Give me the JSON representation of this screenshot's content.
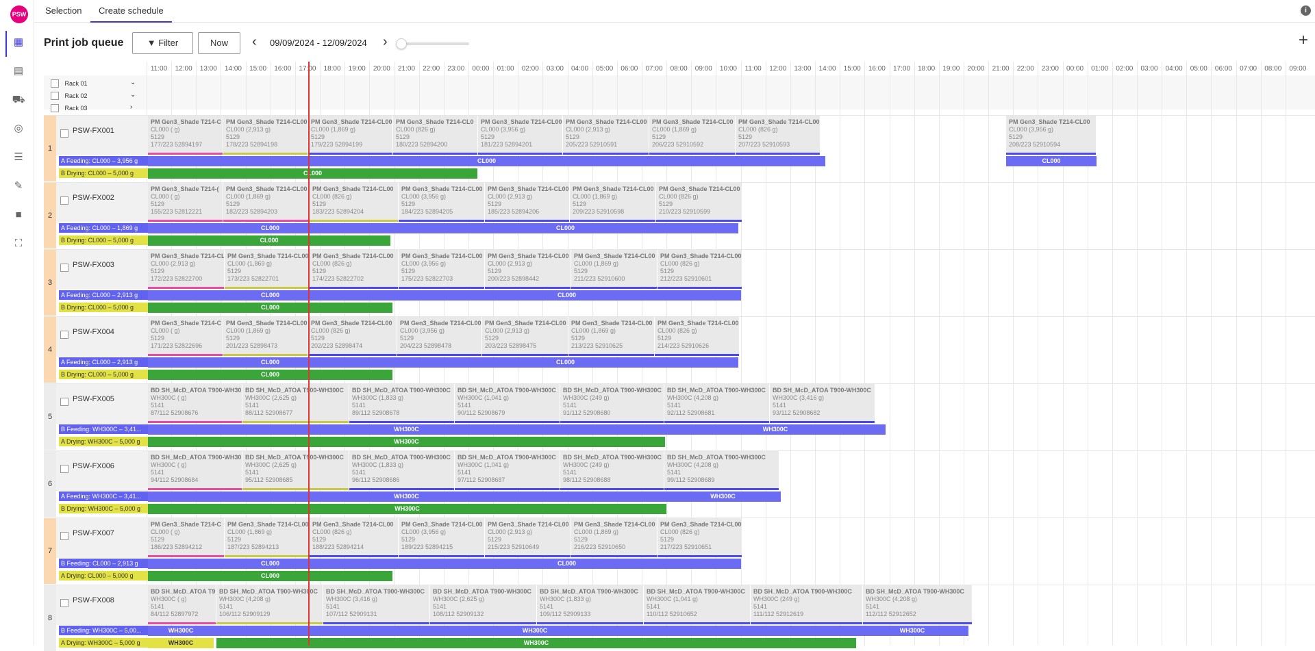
{
  "app": {
    "logo_text": "PSW"
  },
  "tabs": [
    {
      "label": "Selection"
    },
    {
      "label": "Create schedule"
    }
  ],
  "sidebar": {
    "icons": [
      "calendar-icon",
      "clipboard-icon",
      "cart-icon",
      "target-icon",
      "list-icon",
      "wrench-icon",
      "lock-icon",
      "scan-icon"
    ]
  },
  "toolbar": {
    "title": "Print job queue",
    "filter_label": "Filter",
    "now_label": "Now",
    "date_range": "09/09/2024 - 12/09/2024"
  },
  "timeline": {
    "hours": [
      "11:00",
      "12:00",
      "13:00",
      "14:00",
      "15:00",
      "16:00",
      "17:00",
      "18:00",
      "19:00",
      "20:00",
      "21:00",
      "22:00",
      "23:00",
      "00:00",
      "01:00",
      "02:00",
      "03:00",
      "04:00",
      "05:00",
      "06:00",
      "07:00",
      "08:00",
      "09:00",
      "10:00",
      "11:00",
      "12:00",
      "13:00",
      "14:00",
      "15:00",
      "16:00",
      "17:00",
      "18:00",
      "19:00",
      "20:00",
      "21:00",
      "22:00",
      "23:00",
      "00:00",
      "01:00",
      "02:00",
      "03:00",
      "04:00",
      "05:00",
      "06:00",
      "07:00",
      "08:00",
      "09:00"
    ]
  },
  "racks": [
    {
      "label": "Rack 01",
      "chevron": "⌄"
    },
    {
      "label": "Rack 02",
      "chevron": "⌄"
    },
    {
      "label": "Rack 03",
      "chevron": "›"
    }
  ],
  "colors": {
    "accent": "#3b35d8",
    "feed_blue": "#6262f0",
    "drying_green": "#3aa63a",
    "drying_yellow": "#e2e247",
    "now_line": "#e53232",
    "pink": "#e84ca0",
    "olive": "#c9c84a"
  },
  "machines": [
    {
      "num": "1",
      "color": "orange",
      "name": "PSW-FX001",
      "feed_a": "A Feeding: CL000 – 3,956 g",
      "feed_b": "B Drying: CL000 – 5,000 g",
      "jobs": [
        {
          "t": "PM Gen3_Shade T214-C",
          "l2": "CL000 ( g)",
          "l3": "5129",
          "l4": "177/223   52894197",
          "ul": "#e84ca0"
        },
        {
          "t": "PM Gen3_Shade T214-CL00",
          "l2": "CL000 (2,913 g)",
          "l3": "5129",
          "l4": "178/223   52894198",
          "ul": "#c9c84a"
        },
        {
          "t": "PM Gen3_Shade T214-CL00",
          "l2": "CL000 (1,869 g)",
          "l3": "5129",
          "l4": "179/223   52894199",
          "ul": "#4a4af0"
        },
        {
          "t": "PM Gen3_Shade T214-CL0",
          "l2": "CL000 (826 g)",
          "l3": "5129",
          "l4": "180/223   52894200",
          "ul": "#4a4af0"
        },
        {
          "t": "PM Gen3_Shade T214-CL00",
          "l2": "CL000 (3,956 g)",
          "l3": "5129",
          "l4": "181/223   52894201",
          "ul": "#4a4af0"
        },
        {
          "t": "PM Gen3_Shade T214-CL00",
          "l2": "CL000 (2,913 g)",
          "l3": "5129",
          "l4": "205/223   52910591",
          "ul": "#4a4af0"
        },
        {
          "t": "PM Gen3_Shade T214-CL00",
          "l2": "CL000 (1,869 g)",
          "l3": "5129",
          "l4": "206/223   52910592",
          "ul": "#4a4af0"
        },
        {
          "t": "PM Gen3_Shade T214-CL00",
          "l2": "CL000 (826 g)",
          "l3": "5129",
          "l4": "207/223   52910593",
          "ul": "#4a4af0"
        },
        {
          "t": "PM Gen3_Shade T214-CL00",
          "l2": "CL000 (3,956 g)",
          "l3": "5129",
          "l4": "208/223   52910594",
          "ul": "#4a4af0"
        }
      ],
      "bars": [
        {
          "label": "CL000"
        },
        {
          "label": "CL000"
        },
        {
          "label": "CL000"
        },
        {
          "label": "CL000"
        }
      ]
    },
    {
      "num": "2",
      "color": "orange",
      "name": "PSW-FX002",
      "feed_a": "A Feeding: CL000 – 1,869 g",
      "feed_b": "B Drying: CL000 – 5,000 g",
      "jobs": [
        {
          "t": "PM Gen3_Shade T214-(",
          "l2": "CL000 ( g)",
          "l3": "5129",
          "l4": "155/223   52812221",
          "ul": "#e84ca0"
        },
        {
          "t": "PM Gen3_Shade T214-CL00",
          "l2": "CL000 (1,869 g)",
          "l3": "5129",
          "l4": "182/223   52894203",
          "ul": "#e84ca0"
        },
        {
          "t": "PM Gen3_Shade T214-CL00",
          "l2": "CL000 (826 g)",
          "l3": "5129",
          "l4": "183/223   52894204",
          "ul": "#c9c84a"
        },
        {
          "t": "PM Gen3_Shade T214-CL00",
          "l2": "CL000 (3,956 g)",
          "l3": "5129",
          "l4": "184/223   52894205",
          "ul": "#4a4af0"
        },
        {
          "t": "PM Gen3_Shade T214-CL00",
          "l2": "CL000 (2,913 g)",
          "l3": "5129",
          "l4": "185/223   52894206",
          "ul": "#4a4af0"
        },
        {
          "t": "PM Gen3_Shade T214-CL00",
          "l2": "CL000 (1,869 g)",
          "l3": "5129",
          "l4": "209/223   52910598",
          "ul": "#4a4af0"
        },
        {
          "t": "PM Gen3_Shade T214-CL00",
          "l2": "CL000 (826 g)",
          "l3": "5129",
          "l4": "210/223   52910599",
          "ul": "#4a4af0"
        }
      ],
      "bars": [
        {
          "label": "CL000"
        },
        {
          "label": "CL000"
        },
        {
          "label": "CL000"
        }
      ]
    },
    {
      "num": "3",
      "color": "orange",
      "name": "PSW-FX003",
      "feed_a": "A Feeding: CL000 – 2,913 g",
      "feed_b": "B Drying: CL000 – 5,000 g",
      "jobs": [
        {
          "t": "PM Gen3_Shade T214-CL",
          "l2": "CL000 (2,913 g)",
          "l3": "5129",
          "l4": "172/223   52822700",
          "ul": "#e84ca0"
        },
        {
          "t": "PM Gen3_Shade T214-CL00",
          "l2": "CL000 (1,869 g)",
          "l3": "5129",
          "l4": "173/223   52822701",
          "ul": "#c9c84a"
        },
        {
          "t": "PM Gen3_Shade T214-CL00",
          "l2": "CL000 (826 g)",
          "l3": "5129",
          "l4": "174/223   52822702",
          "ul": "#4a4af0"
        },
        {
          "t": "PM Gen3_Shade T214-CL00",
          "l2": "CL000 (3,956 g)",
          "l3": "5129",
          "l4": "175/223   52822703",
          "ul": "#4a4af0"
        },
        {
          "t": "PM Gen3_Shade T214-CL00",
          "l2": "CL000 (2,913 g)",
          "l3": "5129",
          "l4": "200/223   52898442",
          "ul": "#4a4af0"
        },
        {
          "t": "PM Gen3_Shade T214-CL00",
          "l2": "CL000 (1,869 g)",
          "l3": "5129",
          "l4": "211/223   52910600",
          "ul": "#4a4af0"
        },
        {
          "t": "PM Gen3_Shade T214-CL00",
          "l2": "CL000 (826 g)",
          "l3": "5129",
          "l4": "212/223   52910601",
          "ul": "#4a4af0"
        }
      ],
      "bars": [
        {
          "label": "CL000"
        },
        {
          "label": "CL000"
        },
        {
          "label": "CL000"
        }
      ]
    },
    {
      "num": "4",
      "color": "orange",
      "name": "PSW-FX004",
      "feed_a": "A Feeding: CL000 – 2,913 g",
      "feed_b": "B Drying: CL000 – 5,000 g",
      "jobs": [
        {
          "t": "PM Gen3_Shade T214-C",
          "l2": "CL000 ( g)",
          "l3": "5129",
          "l4": "171/223   52822696",
          "ul": "#e84ca0"
        },
        {
          "t": "PM Gen3_Shade T214-CL00",
          "l2": "CL000 (1,869 g)",
          "l3": "5129",
          "l4": "201/223   52898473",
          "ul": "#c9c84a"
        },
        {
          "t": "PM Gen3_Shade T214-CL00",
          "l2": "CL000 (826 g)",
          "l3": "5129",
          "l4": "202/223   52898474",
          "ul": "#4a4af0"
        },
        {
          "t": "PM Gen3_Shade T214-CL00",
          "l2": "CL000 (3,956 g)",
          "l3": "5129",
          "l4": "204/223   52898478",
          "ul": "#4a4af0"
        },
        {
          "t": "PM Gen3_Shade T214-CL00",
          "l2": "CL000 (2,913 g)",
          "l3": "5129",
          "l4": "203/223   52898475",
          "ul": "#4a4af0"
        },
        {
          "t": "PM Gen3_Shade T214-CL00",
          "l2": "CL000 (1,869 g)",
          "l3": "5129",
          "l4": "213/223   52910625",
          "ul": "#4a4af0"
        },
        {
          "t": "PM Gen3_Shade T214-CL00",
          "l2": "CL000 (826 g)",
          "l3": "5129",
          "l4": "214/223   52910626",
          "ul": "#4a4af0"
        }
      ],
      "bars": [
        {
          "label": "CL000"
        },
        {
          "label": "CL000"
        },
        {
          "label": "CL000"
        }
      ]
    },
    {
      "num": "5",
      "color": "gray",
      "name": "PSW-FX005",
      "feed_a": "B Feeding: WH300C – 3,41...",
      "feed_b": "A Drying: WH300C – 5,000 g",
      "jobs": [
        {
          "t": "BD SH_McD_ATOA T900-WH30",
          "l2": "WH300C ( g)",
          "l3": "5141",
          "l4": "87/112   52908676",
          "ul": "#e84ca0"
        },
        {
          "t": "BD SH_McD_ATOA T900-WH300C",
          "l2": "WH300C (2,625 g)",
          "l3": "5141",
          "l4": "88/112   52908677",
          "ul": "#c9c84a"
        },
        {
          "t": "BD SH_McD_ATOA T900-WH300C",
          "l2": "WH300C (1,833 g)",
          "l3": "5141",
          "l4": "89/112   52908678",
          "ul": "#4a4af0"
        },
        {
          "t": "BD SH_McD_ATOA T900-WH300C",
          "l2": "WH300C (1,041 g)",
          "l3": "5141",
          "l4": "90/112   52908679",
          "ul": "#4a4af0"
        },
        {
          "t": "BD SH_McD_ATOA T900-WH300C",
          "l2": "WH300C (249 g)",
          "l3": "5141",
          "l4": "91/112   52908680",
          "ul": "#4a4af0"
        },
        {
          "t": "BD SH_McD_ATOA T900-WH300C",
          "l2": "WH300C (4,208 g)",
          "l3": "5141",
          "l4": "92/112   52908681",
          "ul": "#4a4af0"
        },
        {
          "t": "BD SH_McD_ATOA T900-WH300C",
          "l2": "WH300C (3,416 g)",
          "l3": "5141",
          "l4": "93/112   52908682",
          "ul": "#4a4af0"
        }
      ],
      "bars": [
        {
          "label": "WH300C"
        },
        {
          "label": "WH300C"
        },
        {
          "label": "WH300C"
        }
      ]
    },
    {
      "num": "6",
      "color": "gray",
      "name": "PSW-FX006",
      "feed_a": "A Feeding: WH300C – 3,41...",
      "feed_b": "B Drying: WH300C – 5,000 g",
      "jobs": [
        {
          "t": "BD SH_McD_ATOA T900-WH30",
          "l2": "WH300C ( g)",
          "l3": "5141",
          "l4": "94/112   52908684",
          "ul": "#e84ca0"
        },
        {
          "t": "BD SH_McD_ATOA T900-WH300C",
          "l2": "WH300C (2,625 g)",
          "l3": "5141",
          "l4": "95/112   52908685",
          "ul": "#c9c84a"
        },
        {
          "t": "BD SH_McD_ATOA T900-WH300C",
          "l2": "WH300C (1,833 g)",
          "l3": "5141",
          "l4": "96/112   52908686",
          "ul": "#4a4af0"
        },
        {
          "t": "BD SH_McD_ATOA T900-WH300C",
          "l2": "WH300C (1,041 g)",
          "l3": "5141",
          "l4": "97/112   52908687",
          "ul": "#4a4af0"
        },
        {
          "t": "BD SH_McD_ATOA T900-WH300C",
          "l2": "WH300C (249 g)",
          "l3": "5141",
          "l4": "98/112   52908688",
          "ul": "#4a4af0"
        },
        {
          "t": "BD SH_McD_ATOA T900-WH300C",
          "l2": "WH300C (4,208 g)",
          "l3": "5141",
          "l4": "99/112   52908689",
          "ul": "#4a4af0"
        }
      ],
      "bars": [
        {
          "label": "WH300C"
        },
        {
          "label": "WH300C"
        },
        {
          "label": "WH300C"
        }
      ]
    },
    {
      "num": "7",
      "color": "orange",
      "name": "PSW-FX007",
      "feed_a": "B Feeding: CL000 – 2,913 g",
      "feed_b": "A Drying: CL000 – 5,000 g",
      "jobs": [
        {
          "t": "PM Gen3_Shade T214-C",
          "l2": "CL000 ( g)",
          "l3": "5129",
          "l4": "186/223   52894212",
          "ul": "#e84ca0"
        },
        {
          "t": "PM Gen3_Shade T214-CL00",
          "l2": "CL000 (1,869 g)",
          "l3": "5129",
          "l4": "187/223   52894213",
          "ul": "#c9c84a"
        },
        {
          "t": "PM Gen3_Shade T214-CL00",
          "l2": "CL000 (826 g)",
          "l3": "5129",
          "l4": "188/223   52894214",
          "ul": "#4a4af0"
        },
        {
          "t": "PM Gen3_Shade T214-CL00",
          "l2": "CL000 (3,956 g)",
          "l3": "5129",
          "l4": "189/223   52894215",
          "ul": "#4a4af0"
        },
        {
          "t": "PM Gen3_Shade T214-CL00",
          "l2": "CL000 (2,913 g)",
          "l3": "5129",
          "l4": "215/223   52910649",
          "ul": "#4a4af0"
        },
        {
          "t": "PM Gen3_Shade T214-CL00",
          "l2": "CL000 (1,869 g)",
          "l3": "5129",
          "l4": "216/223   52910650",
          "ul": "#4a4af0"
        },
        {
          "t": "PM Gen3_Shade T214-CL00",
          "l2": "CL000 (826 g)",
          "l3": "5129",
          "l4": "217/223   52910651",
          "ul": "#4a4af0"
        }
      ],
      "bars": [
        {
          "label": "CL000"
        },
        {
          "label": "CL000"
        },
        {
          "label": "CL000"
        }
      ]
    },
    {
      "num": "8",
      "color": "gray",
      "name": "PSW-FX008",
      "feed_a": "B Feeding: WH300C – 5,00...",
      "feed_b": "A Drying: WH300C – 5,000 g",
      "jobs": [
        {
          "t": "BD SH_McD_ATOA T9",
          "l2": "WH300C ( g)",
          "l3": "5141",
          "l4": "84/112   52897972",
          "ul": "#e84ca0"
        },
        {
          "t": "BD SH_McD_ATOA T900-WH300C",
          "l2": "WH300C (4,208 g)",
          "l3": "5141",
          "l4": "106/112   52909129",
          "ul": "#c9c84a"
        },
        {
          "t": "BD SH_McD_ATOA T900-WH300C",
          "l2": "WH300C (3,416 g)",
          "l3": "5141",
          "l4": "107/112   52909131",
          "ul": "#4a4af0"
        },
        {
          "t": "BD SH_McD_ATOA T900-WH300C",
          "l2": "WH300C (2,625 g)",
          "l3": "5141",
          "l4": "108/112   52909132",
          "ul": "#4a4af0"
        },
        {
          "t": "BD SH_McD_ATOA T900-WH300C",
          "l2": "WH300C (1,833 g)",
          "l3": "5141",
          "l4": "109/112   52909133",
          "ul": "#4a4af0"
        },
        {
          "t": "BD SH_McD_ATOA T900-WH300C",
          "l2": "WH300C (1,041 g)",
          "l3": "5141",
          "l4": "110/112   52910652",
          "ul": "#4a4af0"
        },
        {
          "t": "BD SH_McD_ATOA T900-WH300C",
          "l2": "WH300C (249 g)",
          "l3": "5141",
          "l4": "111/112   52912619",
          "ul": "#4a4af0"
        },
        {
          "t": "BD SH_McD_ATOA T900-WH300C",
          "l2": "WH300C (4,208 g)",
          "l3": "5141",
          "l4": "112/112   52912652",
          "ul": "#4a4af0"
        }
      ],
      "bars": [
        {
          "label": "WH300C"
        },
        {
          "label": "WH300C"
        },
        {
          "label": "WH300C"
        },
        {
          "label": "WH300C"
        },
        {
          "label": "WH300C"
        }
      ]
    }
  ]
}
